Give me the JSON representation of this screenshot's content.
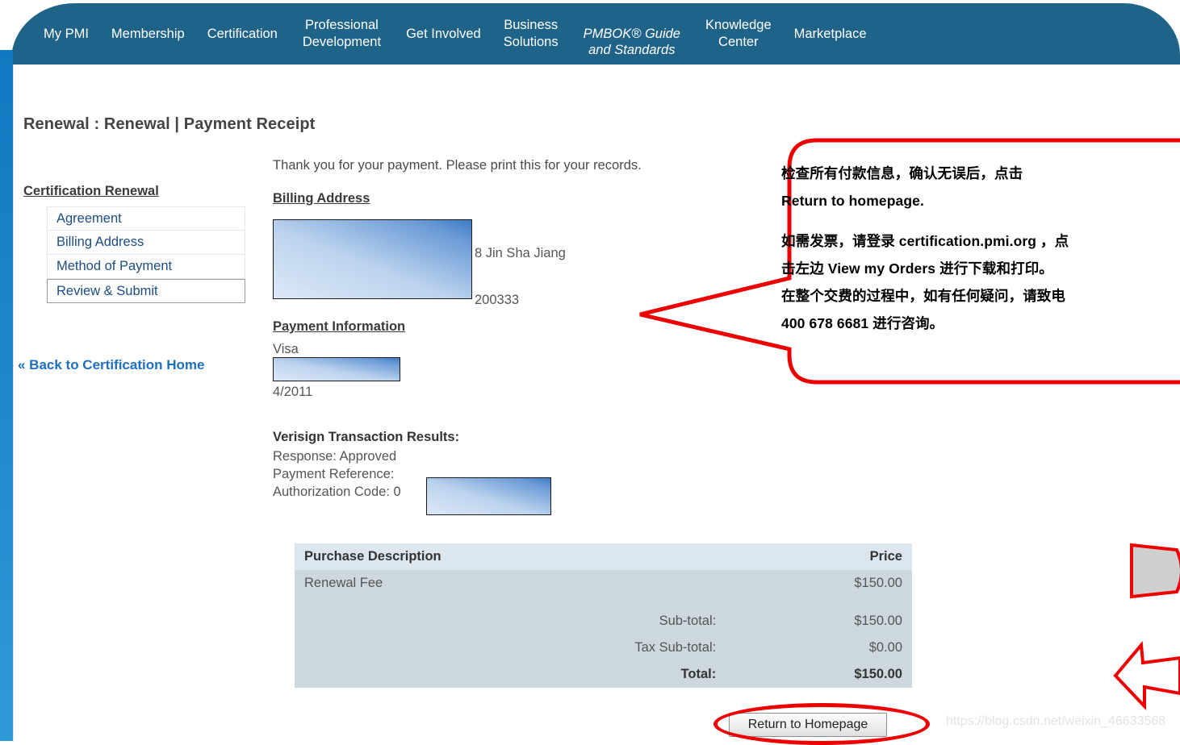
{
  "nav": {
    "items": [
      {
        "label": "My PMI"
      },
      {
        "label": "Membership"
      },
      {
        "label": "Certification"
      },
      {
        "label": "Professional\nDevelopment"
      },
      {
        "label": "Get Involved"
      },
      {
        "label": "Business\nSolutions"
      },
      {
        "label": "PMBOK® Guide\nand Standards"
      },
      {
        "label": "Knowledge\nCenter"
      },
      {
        "label": "Marketplace"
      }
    ],
    "bar_color": "#1f6389",
    "rail_color": "#0d79c0"
  },
  "page": {
    "title": "Renewal : Renewal | Payment Receipt"
  },
  "sidebar": {
    "heading": "Certification Renewal",
    "items": [
      {
        "label": "Agreement"
      },
      {
        "label": "Billing Address"
      },
      {
        "label": "Method of Payment"
      },
      {
        "label": "Review & Submit"
      }
    ],
    "back_link": "« Back to Certification Home"
  },
  "main": {
    "thank_you": "Thank you for your payment. Please print this for your records.",
    "billing_heading": "Billing Address",
    "billing_street_suffix": "8 Jin Sha Jiang",
    "billing_zip_suffix": "200333",
    "payment_heading": "Payment Information",
    "card_type": "Visa",
    "card_expiry": "4/2011",
    "verisign": {
      "title": "Verisign Transaction Results:",
      "response_label": "Response: Approved",
      "payment_reference_label": "Payment Reference:",
      "authorization_code_label": "Authorization Code: 0"
    }
  },
  "table": {
    "headers": [
      "Purchase Description",
      "Price"
    ],
    "rows": [
      {
        "label": "Renewal Fee",
        "price": "$150.00",
        "bold": false
      },
      {
        "label": "Sub-total:",
        "price": "$150.00",
        "bold": false
      },
      {
        "label": "Tax Sub-total:",
        "price": "$0.00",
        "bold": false
      },
      {
        "label": "Total:",
        "price": "$150.00",
        "bold": true
      }
    ],
    "header_bg": "#dbe6ef",
    "row_bg": "#ccd8dd"
  },
  "actions": {
    "return_home_label": "Return to Homepage"
  },
  "callout": {
    "line1": "检查所有付款信息，确认无误后，点击",
    "line2": "Return to homepage.",
    "line3": "如需发票，请登录 certification.pmi.org ，点",
    "line4": "击左边 View my Orders 进行下载和打印。",
    "line5": "在整个交费的过程中，如有任何疑问，请致电",
    "line6": "400 678 6681 进行咨询。",
    "border_color": "#ee0000"
  },
  "watermark": {
    "text": "https://blog.csdn.net/weixin_46633568"
  }
}
